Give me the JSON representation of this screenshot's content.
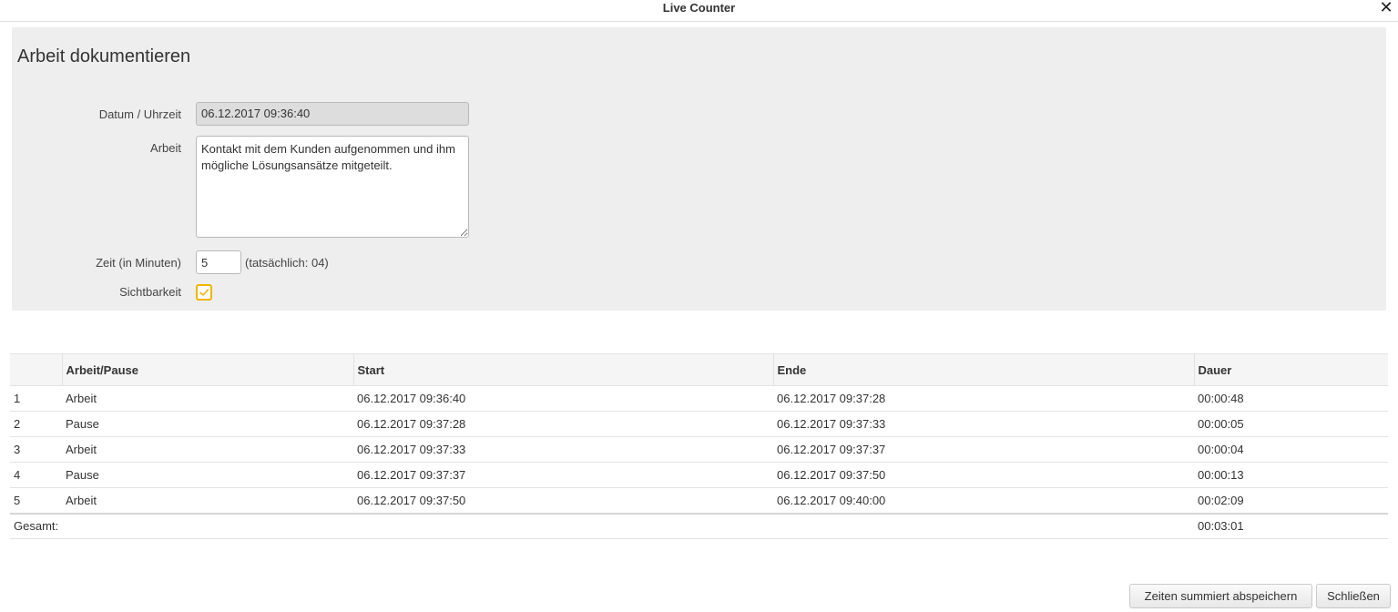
{
  "window": {
    "title": "Live Counter",
    "close_glyph": "✕"
  },
  "form": {
    "heading": "Arbeit dokumentieren",
    "datetime_label": "Datum / Uhrzeit",
    "datetime_value": "06.12.2017 09:36:40",
    "work_label": "Arbeit",
    "work_value": "Kontakt mit dem Kunden aufgenommen und ihm mögliche Lösungsansätze mitgeteilt.",
    "time_label": "Zeit (in Minuten)",
    "time_value": "5",
    "time_hint": "(tatsächlich: 04)",
    "visibility_label": "Sichtbarkeit",
    "visibility_checked": true,
    "checkbox_color": "#f0b400"
  },
  "table": {
    "columns": [
      "",
      "Arbeit/Pause",
      "Start",
      "Ende",
      "Dauer"
    ],
    "rows": [
      [
        "1",
        "Arbeit",
        "06.12.2017 09:36:40",
        "06.12.2017 09:37:28",
        "00:00:48"
      ],
      [
        "2",
        "Pause",
        "06.12.2017 09:37:28",
        "06.12.2017 09:37:33",
        "00:00:05"
      ],
      [
        "3",
        "Arbeit",
        "06.12.2017 09:37:33",
        "06.12.2017 09:37:37",
        "00:00:04"
      ],
      [
        "4",
        "Pause",
        "06.12.2017 09:37:37",
        "06.12.2017 09:37:50",
        "00:00:13"
      ],
      [
        "5",
        "Arbeit",
        "06.12.2017 09:37:50",
        "06.12.2017 09:40:00",
        "00:02:09"
      ]
    ],
    "total_label": "Gesamt:",
    "total_value": "00:03:01"
  },
  "buttons": {
    "save_summed": "Zeiten summiert abspeichern",
    "close": "Schließen"
  }
}
